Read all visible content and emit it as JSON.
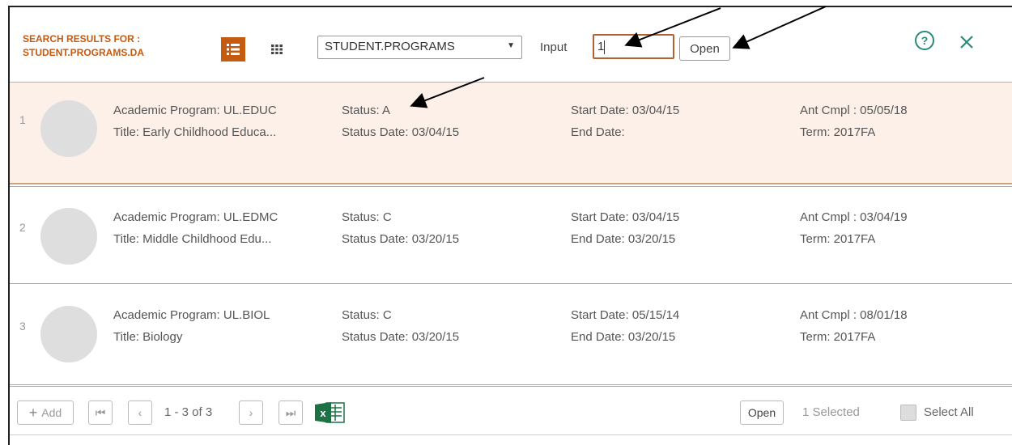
{
  "header": {
    "title_line1": "SEARCH RESULTS FOR :",
    "title_line2": "STUDENT.PROGRAMS.DA",
    "select_value": "STUDENT.PROGRAMS",
    "input_label": "Input",
    "input_value": "1",
    "open_label": "Open",
    "icons": [
      "list-view-icon",
      "grid-view-icon",
      "help-icon",
      "close-icon"
    ]
  },
  "rows": [
    {
      "index": "1",
      "program": "Academic Program: UL.EDUC",
      "title": "Title: Early Childhood Educa...",
      "status": "Status: A",
      "status_date": "Status Date: 03/04/15",
      "start_date": "Start Date: 03/04/15",
      "end_date": "End Date:",
      "ant_cmpl": "Ant Cmpl : 05/05/18",
      "term": "Term: 2017FA"
    },
    {
      "index": "2",
      "program": "Academic Program: UL.EDMC",
      "title": "Title: Middle Childhood Edu...",
      "status": "Status: C",
      "status_date": "Status Date: 03/20/15",
      "start_date": "Start Date: 03/04/15",
      "end_date": "End Date: 03/20/15",
      "ant_cmpl": "Ant Cmpl : 03/04/19",
      "term": "Term: 2017FA"
    },
    {
      "index": "3",
      "program": "Academic Program: UL.BIOL",
      "title": "Title: Biology",
      "status": "Status: C",
      "status_date": "Status Date: 03/20/15",
      "start_date": "Start Date: 05/15/14",
      "end_date": "End Date: 03/20/15",
      "ant_cmpl": "Ant Cmpl : 08/01/18",
      "term": "Term: 2017FA"
    }
  ],
  "footer": {
    "add_label": "Add",
    "pagination": "1 - 3 of 3",
    "open_label": "Open",
    "selected_text": "1 Selected",
    "select_all_label": "Select All"
  },
  "colors": {
    "accent": "#c55a11",
    "selected_row_bg": "#fdf0e8",
    "close_icon": "#2a8a7a",
    "excel_green": "#1e7145"
  }
}
